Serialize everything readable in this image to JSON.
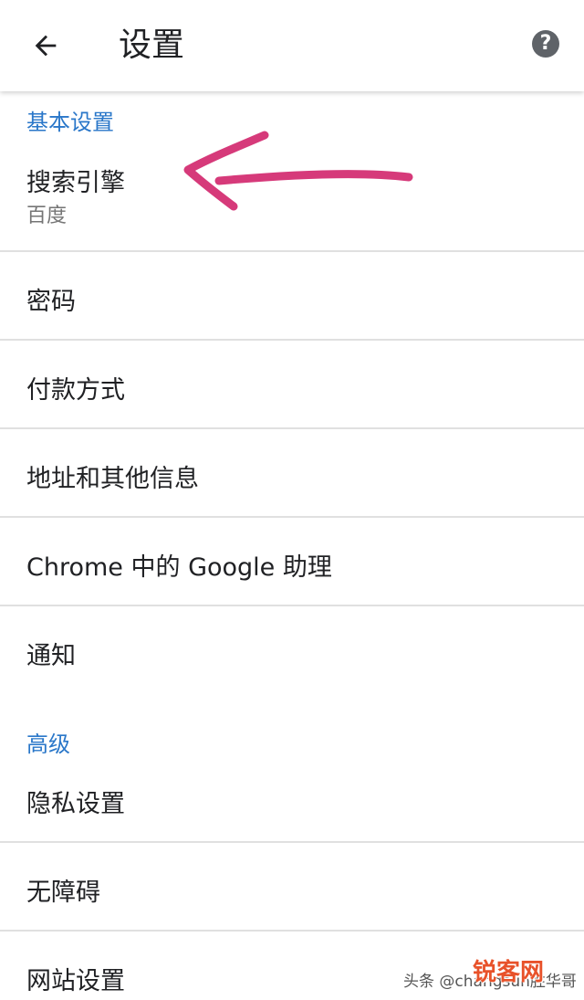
{
  "app_bar": {
    "title": "设置",
    "back_icon": "arrow-left-icon",
    "help_icon": "help-circle-icon",
    "help_glyph": "?"
  },
  "sections": {
    "basic_header": "基本设置",
    "advanced_header": "高级"
  },
  "items": {
    "search_engine": {
      "title": "搜索引擎",
      "subtitle": "百度"
    },
    "passwords": {
      "title": "密码"
    },
    "payment_methods": {
      "title": "付款方式"
    },
    "addresses": {
      "title": "地址和其他信息"
    },
    "assistant": {
      "title": "Chrome 中的 Google 助理"
    },
    "notifications": {
      "title": "通知"
    },
    "privacy": {
      "title": "隐私设置"
    },
    "accessibility": {
      "title": "无障碍"
    },
    "site_settings": {
      "title": "网站设置"
    }
  },
  "annotation": {
    "type": "hand-drawn-arrow",
    "color": "#d63a7a"
  },
  "watermark": {
    "text": "头条 @changsun胜华哥",
    "logo": "锐客网"
  },
  "colors": {
    "accent": "#2a77c9",
    "divider": "#e0e0e0",
    "secondary_text": "#757575"
  }
}
